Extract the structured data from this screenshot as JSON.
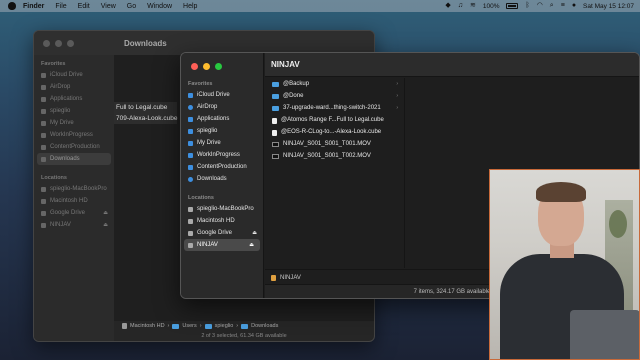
{
  "menubar": {
    "app": "Finder",
    "items": [
      "File",
      "Edit",
      "View",
      "Go",
      "Window",
      "Help"
    ],
    "battery": "100%",
    "clock": "Sat May 15  12:07"
  },
  "back_window": {
    "title": "Downloads",
    "favorites_heading": "Favorites",
    "favorites": [
      "iCloud Drive",
      "AirDrop",
      "Applications",
      "spieglio",
      "My Drive",
      "WorkInProgress",
      "ContentProduction",
      "Downloads"
    ],
    "locations_heading": "Locations",
    "locations": [
      "spieglio-MacBookPro",
      "Macintosh HD",
      "Google Drive",
      "NINJAV"
    ],
    "files": [
      "Full to Legal.cube",
      "709-Alexa-Look.cube"
    ],
    "path": [
      "Macintosh HD",
      "Users",
      "spieglio",
      "Downloads"
    ],
    "status": "2 of 3 selected, 61.34 GB available"
  },
  "front_window": {
    "title": "NINJAV",
    "favorites_heading": "Favorites",
    "favorites": [
      "iCloud Drive",
      "AirDrop",
      "Applications",
      "spieglio",
      "My Drive",
      "WorkInProgress",
      "ContentProduction",
      "Downloads"
    ],
    "locations_heading": "Locations",
    "locations": [
      "spieglio-MacBookPro",
      "Macintosh HD",
      "Google Drive",
      "NINJAV"
    ],
    "files": [
      {
        "name": "@Backup",
        "kind": "folder"
      },
      {
        "name": "@Done",
        "kind": "folder"
      },
      {
        "name": "37-upgrade-ward...thing-switch-2021",
        "kind": "folder"
      },
      {
        "name": "@Atomos Range F...Full to Legal.cube",
        "kind": "doc"
      },
      {
        "name": "@EOS-R-CLog-to...-Alexa-Look.cube",
        "kind": "doc"
      },
      {
        "name": "NINJAV_S001_S001_T001.MOV",
        "kind": "movie"
      },
      {
        "name": "NINJAV_S001_S001_T002.MOV",
        "kind": "movie"
      }
    ],
    "path": "NINJAV",
    "status": "7 items, 324.17 GB available"
  }
}
